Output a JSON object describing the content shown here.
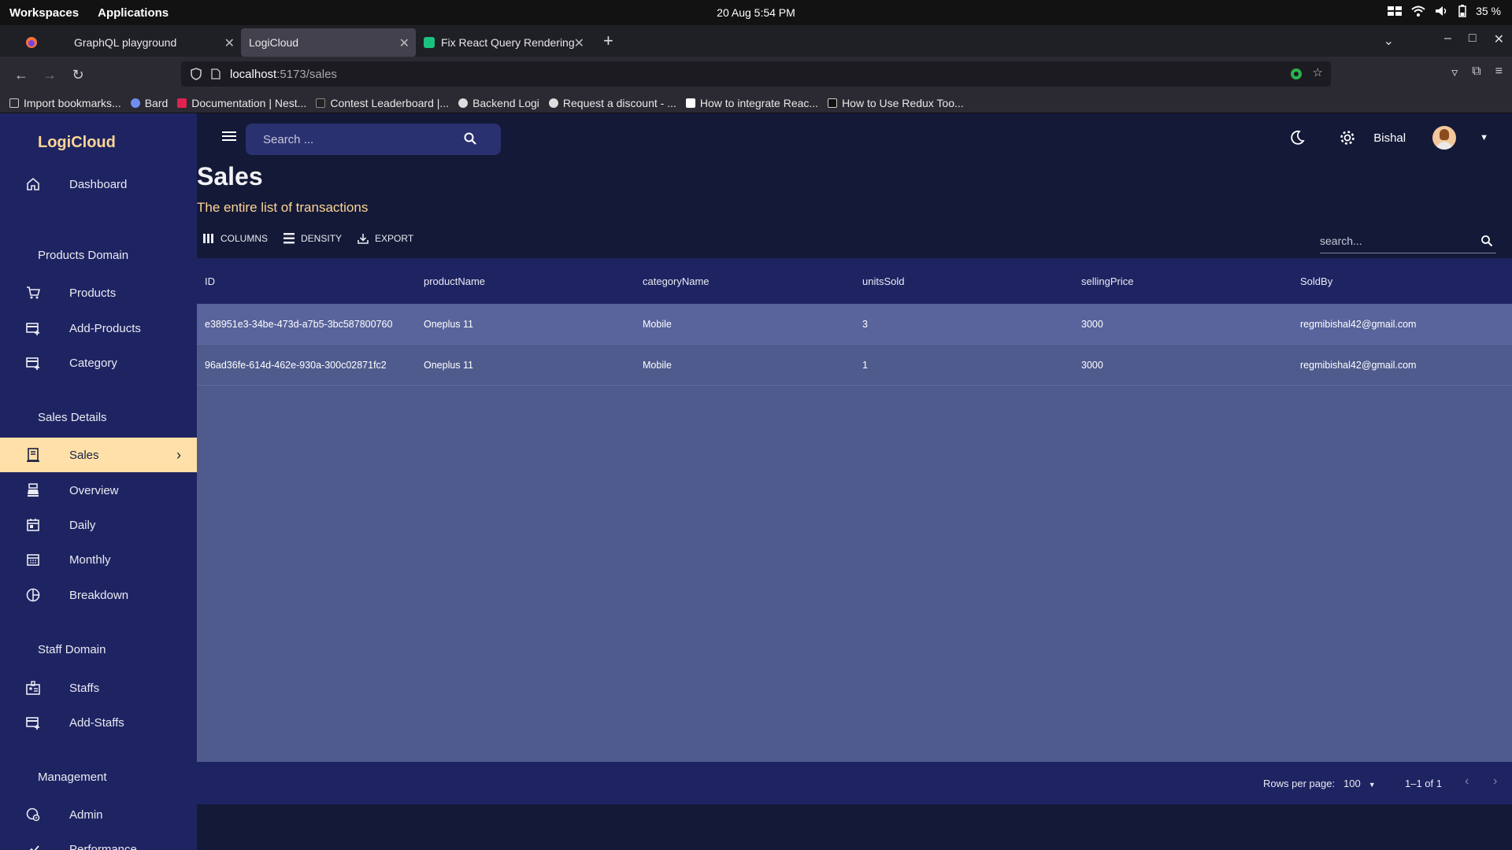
{
  "os": {
    "workspaces": "Workspaces",
    "applications": "Applications",
    "datetime": "20 Aug  5:54 PM",
    "battery": "35 %"
  },
  "browser": {
    "tabs": [
      {
        "title": "GraphQL playground",
        "active": false
      },
      {
        "title": "LogiCloud",
        "active": true
      },
      {
        "title": "Fix React Query Rendering",
        "active": false
      }
    ],
    "url_host": "localhost",
    "url_path": ":5173/sales",
    "bookmarks": [
      "Import bookmarks...",
      "Bard",
      "Documentation | Nest...",
      "Contest Leaderboard |...",
      "Backend Logi",
      "Request a discount - ...",
      "How to integrate Reac...",
      "How to Use Redux Too..."
    ]
  },
  "app": {
    "brand": "LogiCloud",
    "accent": "#ffd596",
    "sidebar": {
      "dashboard": "Dashboard",
      "sections": {
        "products": "Products Domain",
        "sales": "Sales Details",
        "staff": "Staff Domain",
        "management": "Management"
      },
      "items": {
        "products": "Products",
        "add_products": "Add-Products",
        "category": "Category",
        "sales": "Sales",
        "overview": "Overview",
        "daily": "Daily",
        "monthly": "Monthly",
        "breakdown": "Breakdown",
        "staffs": "Staffs",
        "add_staffs": "Add-Staffs",
        "admin": "Admin",
        "performance": "Performance"
      }
    },
    "topbar": {
      "search_placeholder": "Search ...",
      "username": "Bishal"
    },
    "page": {
      "title": "Sales",
      "subtitle": "The entire list of transactions"
    },
    "grid_toolbar": {
      "columns": "COLUMNS",
      "density": "DENSITY",
      "export": "EXPORT",
      "search_placeholder": "search..."
    },
    "table": {
      "headers": [
        "ID",
        "productName",
        "categoryName",
        "unitsSold",
        "sellingPrice",
        "SoldBy"
      ],
      "rows": [
        [
          "e38951e3-34be-473d-a7b5-3bc587800760",
          "Oneplus 11",
          "Mobile",
          "3",
          "3000",
          "regmibishal42@gmail.com"
        ],
        [
          "96ad36fe-614d-462e-930a-300c02871fc2",
          "Oneplus 11",
          "Mobile",
          "1",
          "3000",
          "regmibishal42@gmail.com"
        ]
      ]
    },
    "footer": {
      "rows_per_page_label": "Rows per page:",
      "rows_per_page_value": "100",
      "range": "1–1 of 1"
    }
  }
}
